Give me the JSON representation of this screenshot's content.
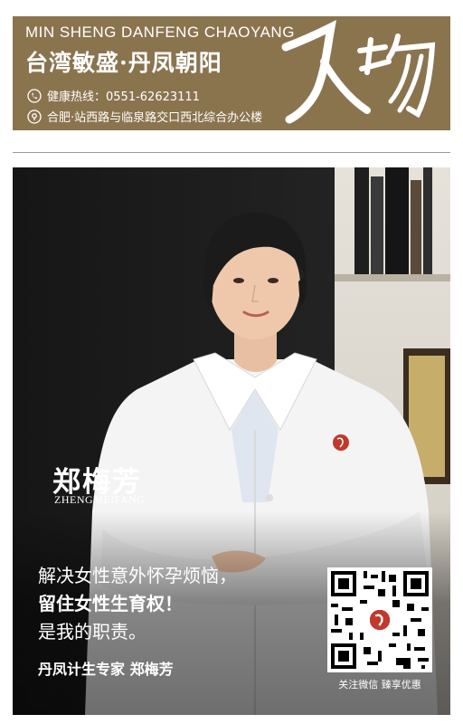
{
  "header": {
    "title_en": "MIN SHENG  DANFENG CHAOYANG",
    "title_cn": "台湾敏盛·丹凤朝阳",
    "hotline": "健康热线：0551-62623111",
    "address": "合肥·站西路与临泉路交口西北综合办公楼",
    "calligraphy": "人物"
  },
  "person": {
    "name_cn": "郑梅芳",
    "name_en": "ZHENGMEIFANG"
  },
  "slogan": {
    "line1": "解决女性意外怀孕烦恼，",
    "line2": "留住女性生育权！",
    "line3": "是我的职责。"
  },
  "expert_label": "丹凤计生专家  郑梅芳",
  "qr": {
    "caption": "关注微信  臻享优惠"
  },
  "colors": {
    "banner": "#8a744e",
    "coat": "#f4f4f4",
    "backdrop": "#1d1d1d"
  }
}
